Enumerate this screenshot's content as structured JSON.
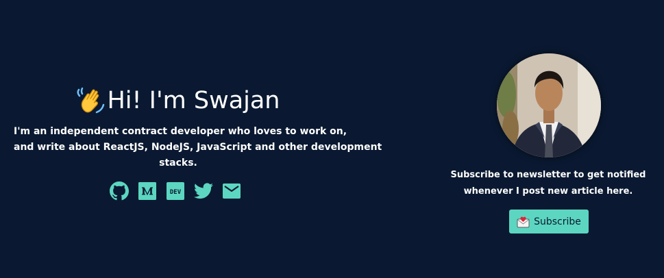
{
  "hero": {
    "greeting": "Hi! I'm Swajan",
    "wave_icon": "waving-hand-icon",
    "bio_lines": [
      "I'm an independent contract developer who loves to work on,",
      "and write about ReactJS, NodeJS, JavaScript and other development",
      "stacks."
    ]
  },
  "socials": [
    {
      "icon": "github-icon"
    },
    {
      "icon": "medium-icon"
    },
    {
      "icon": "dev-icon",
      "label": "DEV"
    },
    {
      "icon": "twitter-icon"
    },
    {
      "icon": "email-icon"
    }
  ],
  "newsletter": {
    "lines": [
      "Subscribe to newsletter to get notified",
      "whenever I post new article here."
    ],
    "button_label": "Subscribe",
    "button_icon": "envelope-with-heart-icon"
  },
  "colors": {
    "background": "#0a1931",
    "accent": "#5cd6c0",
    "text": "#ffffff"
  }
}
